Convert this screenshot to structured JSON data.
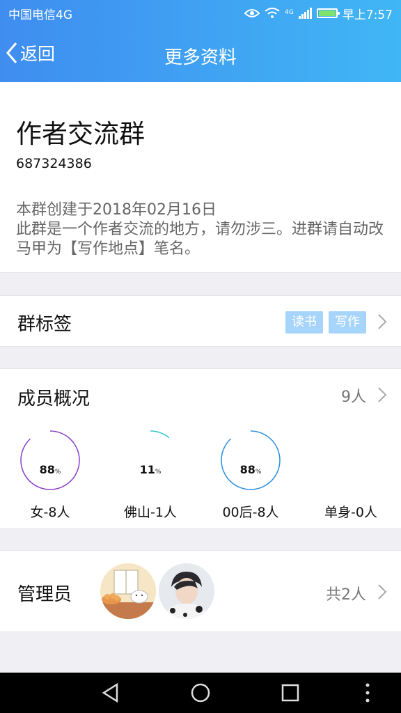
{
  "status_bar": {
    "carrier": "中国电信4G",
    "network_badge": "4G",
    "time": "早上7:57"
  },
  "nav": {
    "back_label": "返回",
    "title": "更多资料"
  },
  "group": {
    "name": "作者交流群",
    "id": "687324386",
    "created": "本群创建于2018年02月16日",
    "description": "此群是一个作者交流的地方，请勿涉三。进群请自动改马甲为【写作地点】笔名。"
  },
  "tags_row": {
    "title": "群标签",
    "tags": [
      "读书",
      "写作"
    ]
  },
  "members_row": {
    "title": "成员概况",
    "count": "9人"
  },
  "member_stats": [
    {
      "value": "88",
      "unit": "%",
      "label": "女-8人",
      "fraction": 0.88,
      "color": "#8a3fc9"
    },
    {
      "value": "11",
      "unit": "%",
      "label": "佛山-1人",
      "fraction": 0.11,
      "color": "#2ec7c9"
    },
    {
      "value": "88",
      "unit": "%",
      "label": "00后-8人",
      "fraction": 0.88,
      "color": "#2b8fe0"
    },
    {
      "value": "",
      "unit": "",
      "label": "单身-0人",
      "fraction": 0,
      "color": "#cccccc"
    }
  ],
  "admins_row": {
    "title": "管理员",
    "count": "共2人",
    "avatars": [
      "admin-avatar-cat",
      "admin-avatar-boy"
    ]
  },
  "icons": {
    "eye": "eye-icon",
    "wifi": "wifi-icon",
    "signal": "signal-icon",
    "battery": "battery-icon",
    "back": "chevron-left-icon",
    "chevron": "chevron-right-icon"
  }
}
